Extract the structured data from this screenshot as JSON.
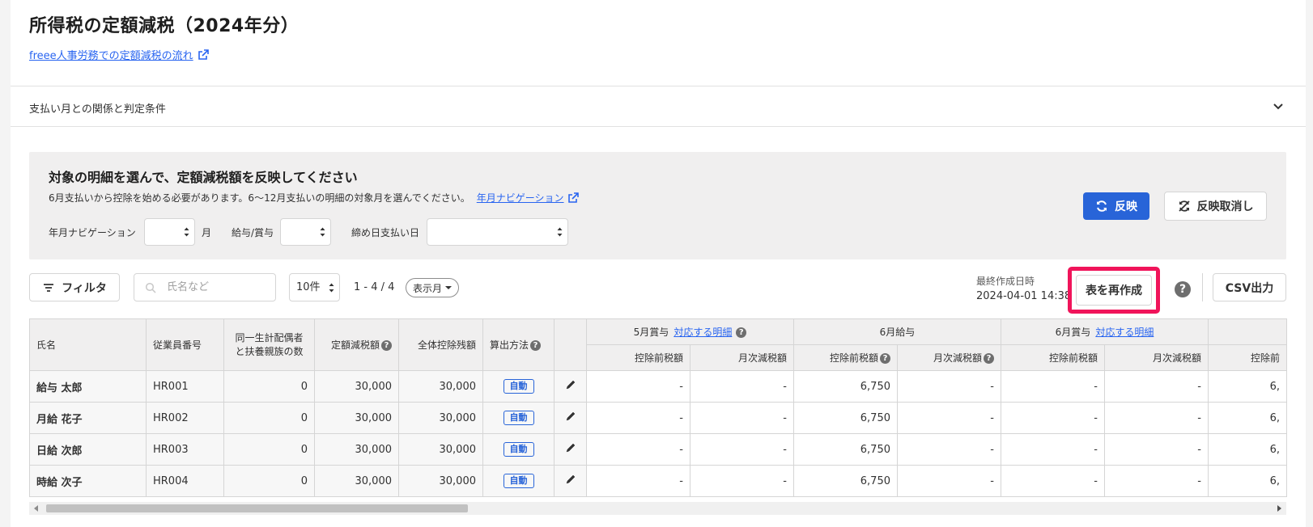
{
  "header": {
    "title": "所得税の定額減税（2024年分）",
    "flow_link": "freee人事労務での定額減税の流れ",
    "accordion_label": "支払い月との関係と判定条件"
  },
  "panel": {
    "heading": "対象の明細を選んで、定額減税額を反映してください",
    "note": "6月支払いから控除を始める必要があります。6〜12月支払いの明細の対象月を選んでください。",
    "nav_link": "年月ナビゲーション",
    "fields": {
      "nav_label": "年月ナビゲーション",
      "month_suffix": "月",
      "pay_type_label": "給与/賞与",
      "closing_label": "締め日支払い日"
    },
    "reflect_button": "反映",
    "cancel_button": "反映取消し"
  },
  "toolbar": {
    "filter_button": "フィルタ",
    "search_placeholder": "氏名など",
    "per_page": "10件",
    "range": "1 - 4 / 4",
    "display_month": "表示月",
    "last_created_label": "最終作成日時",
    "last_created_value": "2024-04-01 14:38",
    "recreate_button": "表を再作成",
    "help": "?",
    "csv_button": "CSV出力"
  },
  "table": {
    "headers": {
      "name": "氏名",
      "employee_no": "従業員番号",
      "dependents": "同一生計配偶者と扶養親族の数",
      "fixed_reduction": "定額減税額",
      "total_balance": "全体控除残額",
      "method": "算出方法",
      "group_may_bonus": "5月賞与",
      "group_june_salary": "6月給与",
      "group_june_bonus": "6月賞与",
      "corresponding_link": "対応する明細",
      "pre_deduction": "控除前税額",
      "monthly_reduction": "月次減税額",
      "pre_deduction_cut": "控除前"
    },
    "method_badge": "自動",
    "rows": [
      {
        "name": "給与 太郎",
        "emp": "HR001",
        "dep": "0",
        "fixed": "30,000",
        "balance": "30,000",
        "may_pre": "-",
        "may_month": "-",
        "jun_pre": "6,750",
        "jun_month": "-",
        "junb_pre": "-",
        "junb_month": "-",
        "next": "6,"
      },
      {
        "name": "月給 花子",
        "emp": "HR002",
        "dep": "0",
        "fixed": "30,000",
        "balance": "30,000",
        "may_pre": "-",
        "may_month": "-",
        "jun_pre": "6,750",
        "jun_month": "-",
        "junb_pre": "-",
        "junb_month": "-",
        "next": "6,"
      },
      {
        "name": "日給 次郎",
        "emp": "HR003",
        "dep": "0",
        "fixed": "30,000",
        "balance": "30,000",
        "may_pre": "-",
        "may_month": "-",
        "jun_pre": "6,750",
        "jun_month": "-",
        "junb_pre": "-",
        "junb_month": "-",
        "next": "6,"
      },
      {
        "name": "時給 次子",
        "emp": "HR004",
        "dep": "0",
        "fixed": "30,000",
        "balance": "30,000",
        "may_pre": "-",
        "may_month": "-",
        "jun_pre": "6,750",
        "jun_month": "-",
        "junb_pre": "-",
        "junb_month": "-",
        "next": "6,"
      }
    ]
  },
  "colors": {
    "primary": "#2864d8",
    "link": "#2864f0",
    "highlight": "#f0145a",
    "panel_bg": "#f0efef"
  }
}
